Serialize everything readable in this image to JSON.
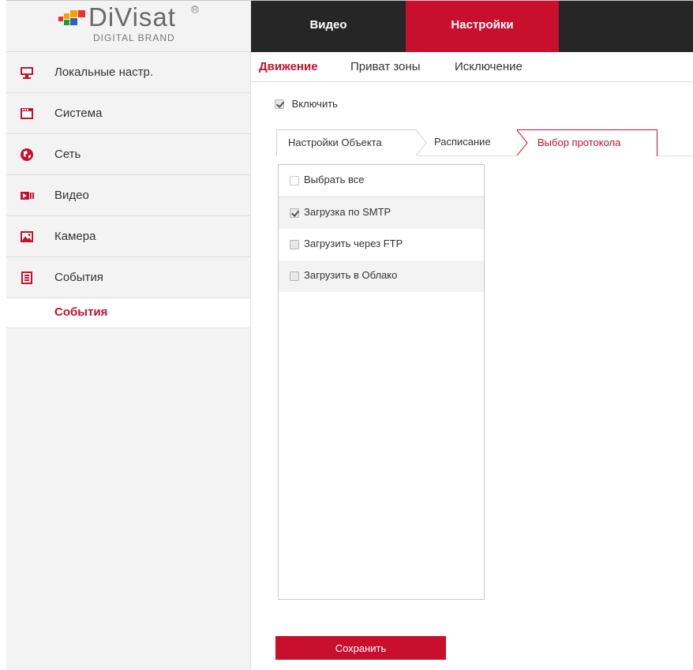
{
  "logo": {
    "brand": "DiVisat",
    "subtitle": "DIGITAL BRAND",
    "reg": "R"
  },
  "topnav": {
    "video": "Видео",
    "settings": "Настройки"
  },
  "sidebar": {
    "items": [
      {
        "label": "Локальные настр.",
        "icon": "monitor-icon"
      },
      {
        "label": "Система",
        "icon": "system-icon"
      },
      {
        "label": "Сеть",
        "icon": "globe-icon"
      },
      {
        "label": "Видео",
        "icon": "video-icon"
      },
      {
        "label": "Камера",
        "icon": "image-icon"
      },
      {
        "label": "События",
        "icon": "events-icon"
      }
    ],
    "sub_item": "События"
  },
  "subtabs": {
    "motion": "Движение",
    "privacy": "Приват зоны",
    "exclusion": "Исключение"
  },
  "enable": {
    "label": "Включить",
    "checked": true
  },
  "steps": {
    "object": "Настройки Объекта",
    "schedule": "Расписание",
    "protocol": "Выбор протокола"
  },
  "protocols": {
    "select_all": "Выбрать все",
    "smtp": "Загрузка по SMTP",
    "ftp": "Загрузить через FTP",
    "cloud": "Загрузить в Облако"
  },
  "save_label": "Сохранить",
  "colors": {
    "accent": "#c8102e",
    "topbar": "#262626",
    "sidebar": "#f3f3f3"
  }
}
